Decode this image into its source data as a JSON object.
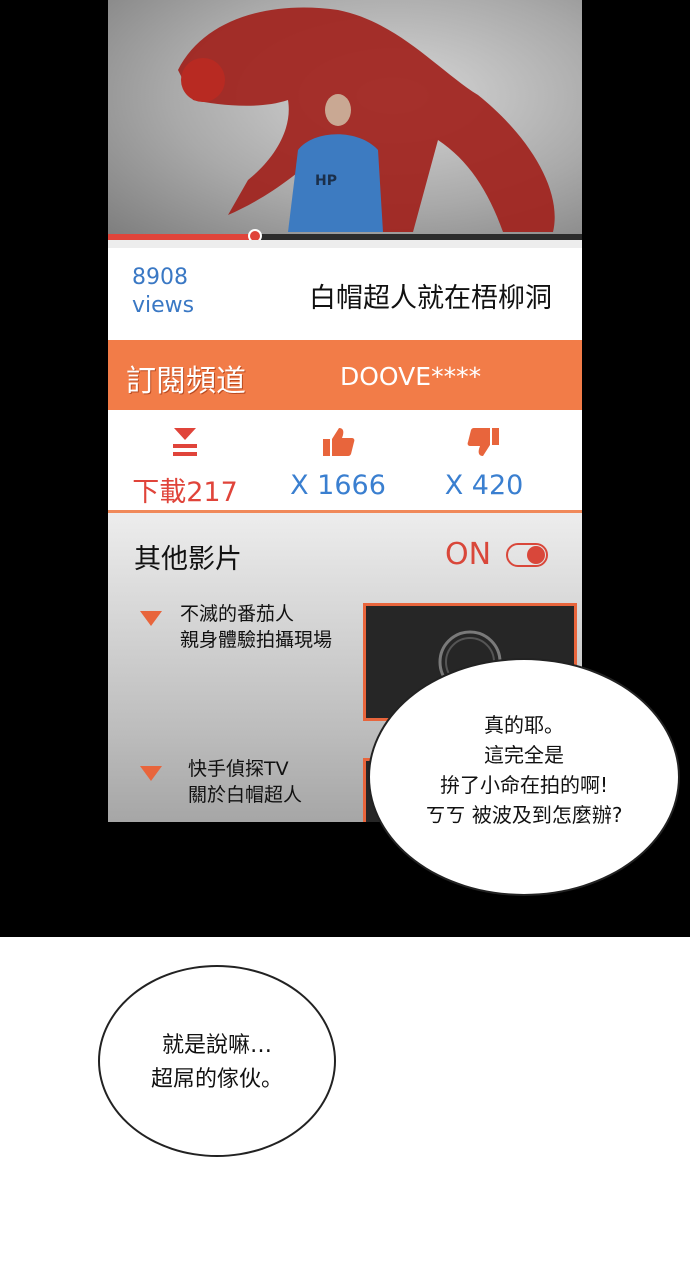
{
  "video": {
    "progress": 0.31
  },
  "info": {
    "views_count": "8908",
    "views_label": "views",
    "title": "白帽超人就在梧柳洞"
  },
  "channel": {
    "subscribe_label": "訂閱頻道",
    "name": "DOOVE****"
  },
  "actions": {
    "download": {
      "icon": "download-icon",
      "label": "下載217",
      "color": "#e0443a"
    },
    "like": {
      "icon": "thumbs-up-icon",
      "label": "X 1666",
      "color": "#3a7fd0"
    },
    "dislike": {
      "icon": "thumbs-down-icon",
      "label": "X 420",
      "color": "#3a7fd0"
    }
  },
  "other_videos": {
    "heading": "其他影片",
    "autoplay_label": "ON",
    "items": [
      {
        "line1": "不滅的番茄人",
        "line2": "親身體驗拍攝現場"
      },
      {
        "line1": "快手偵探TV",
        "line2": "關於白帽超人"
      }
    ]
  },
  "bubbles": {
    "first": {
      "line1": "真的耶。",
      "line2": "這完全是",
      "line3": "拚了小命在拍的啊!",
      "line4": "ㄎㄎ 被波及到怎麼辦?"
    },
    "second": {
      "line1": "就是說嘛…",
      "line2": "超屌的傢伙。"
    }
  },
  "colors": {
    "accent_orange": "#f27c48",
    "progress_red": "#e0443a",
    "views_blue": "#3a78c4"
  }
}
